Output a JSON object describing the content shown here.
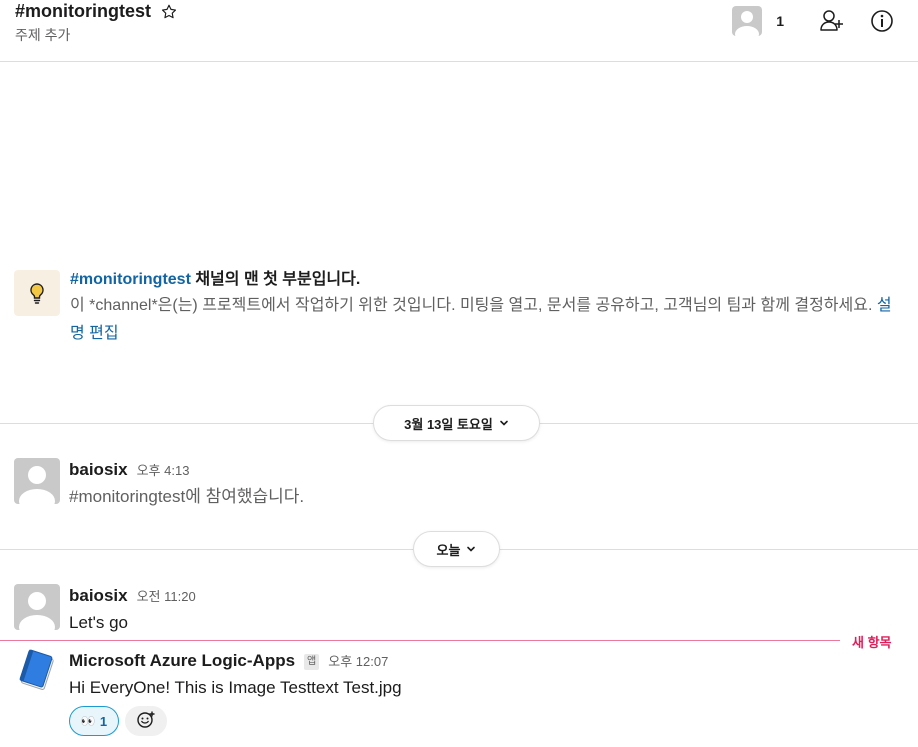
{
  "header": {
    "channel_name": "#monitoringtest",
    "topic": "주제 추가",
    "member_count": "1",
    "icons": {
      "star": "star-icon",
      "add_member": "add-member-icon",
      "info": "info-icon"
    }
  },
  "intro": {
    "channel_link": "#monitoringtest",
    "heading_suffix": " 채널의 맨 첫 부분입니다.",
    "description": "이 *channel*은(는) 프로젝트에서 작업하기 위한 것입니다. 미팅을 열고, 문서를 공유하고, 고객님의 팀과 함께 결정하세요.",
    "edit_link": "설명 편집",
    "icon": "lightbulb-icon"
  },
  "dividers": [
    {
      "label": "3월 13일 토요일"
    },
    {
      "label": "오늘"
    }
  ],
  "messages": [
    {
      "author": "baiosix",
      "time": "오후 4:13",
      "text": "#monitoringtest에 참여했습니다."
    },
    {
      "author": "baiosix",
      "time": "오전 11:20",
      "text": "Let's go"
    },
    {
      "author": "Microsoft Azure Logic-Apps",
      "badge": "앱",
      "time": "오후 12:07",
      "text": "Hi EveryOne! This is Image Testtext Test.jpg"
    }
  ],
  "new_divider_label": "새 항목",
  "reactions": [
    {
      "emoji": "👀",
      "count": "1"
    }
  ],
  "colors": {
    "link": "#1264a3",
    "new": "#e01e5a",
    "reaction_border": "#1d9bd1"
  }
}
